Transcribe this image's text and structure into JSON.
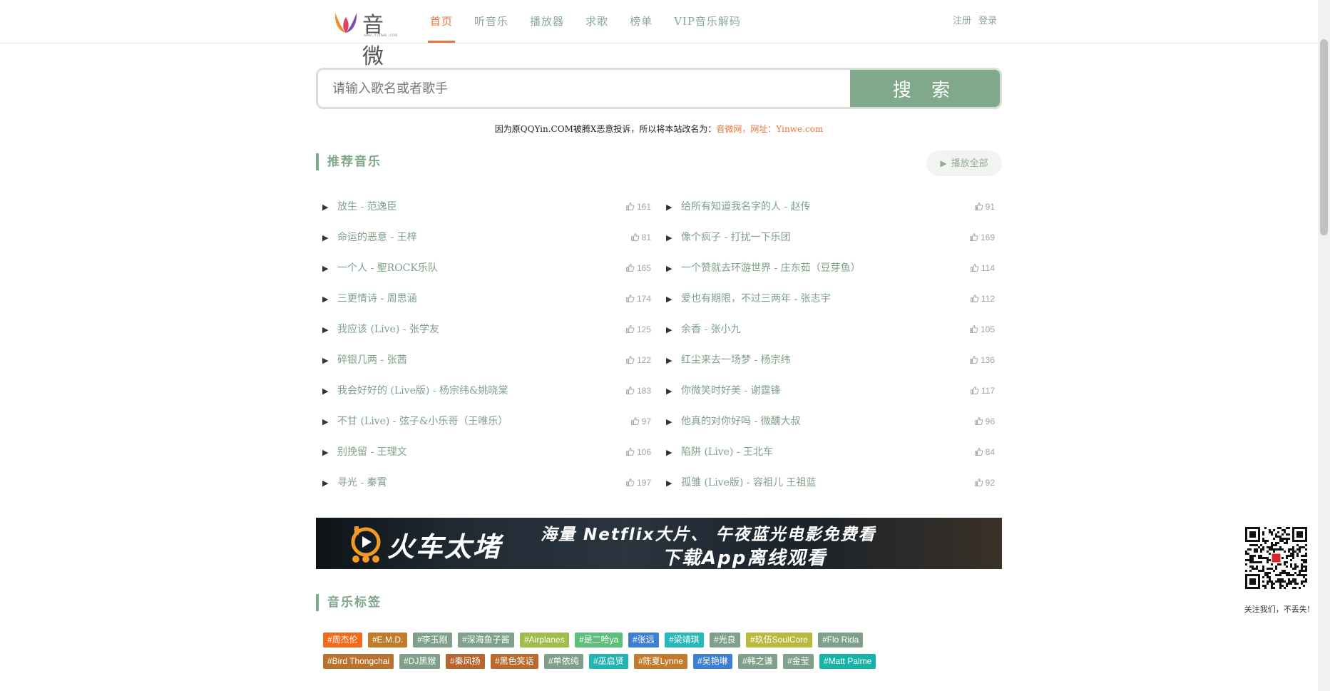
{
  "header": {
    "logo_text": "音微",
    "logo_sub": "www.Yinwe.com",
    "nav": [
      "首页",
      "听音乐",
      "播放器",
      "求歌",
      "榜单",
      "VIP音乐解码"
    ],
    "active_index": 0,
    "register": "注册",
    "login": "登录"
  },
  "search": {
    "placeholder": "请输入歌名或者歌手",
    "button": "搜 索"
  },
  "notice": {
    "text": "因为原QQYin.COM被腾X恶意投诉，所以将本站改名为：",
    "highlight": "音微网，网址：Yinwe.com"
  },
  "recommend": {
    "title": "推荐音乐",
    "play_all": "播放全部",
    "songs": [
      {
        "name": "放生 - 范逸臣",
        "likes": "161"
      },
      {
        "name": "给所有知道我名字的人 - 赵传",
        "likes": "91"
      },
      {
        "name": "命运的恶意 - 王梓",
        "likes": "81"
      },
      {
        "name": "像个疯子 - 打扰一下乐团",
        "likes": "169"
      },
      {
        "name": "一个人 - 聖ROCK乐队",
        "likes": "165"
      },
      {
        "name": "一个赞就去环游世界 - 庄东茹（豆芽鱼）",
        "likes": "114"
      },
      {
        "name": "三更情诗 - 周思涵",
        "likes": "174"
      },
      {
        "name": "爱也有期限，不过三两年 - 张志宇",
        "likes": "112"
      },
      {
        "name": "我应该 (Live) - 张学友",
        "likes": "125"
      },
      {
        "name": "余香 - 张小九",
        "likes": "105"
      },
      {
        "name": "碎银几两 - 张茜",
        "likes": "122"
      },
      {
        "name": "红尘来去一场梦 - 杨宗纬",
        "likes": "136"
      },
      {
        "name": "我会好好的 (Live版) - 杨宗纬&姚晓棠",
        "likes": "183"
      },
      {
        "name": "你微笑时好美 - 谢霆锋",
        "likes": "117"
      },
      {
        "name": "不甘 (Live) - 弦子&小乐哥（王唯乐）",
        "likes": "97"
      },
      {
        "name": "他真的对你好吗 - 微醺大叔",
        "likes": "96"
      },
      {
        "name": "别挽留 - 王理文",
        "likes": "106"
      },
      {
        "name": "陷阱 (Live) - 王北车",
        "likes": "84"
      },
      {
        "name": "寻光 - 秦霄",
        "likes": "197"
      },
      {
        "name": "孤雏 (Live版) - 容祖儿 王祖蓝",
        "likes": "92"
      }
    ]
  },
  "banner": {
    "brand": "火车太堵",
    "line1": "海量 Netflix大片、 午夜蓝光电影免费看",
    "line2": "下载App离线观看"
  },
  "tags_section": {
    "title": "音乐标签",
    "rows": [
      [
        {
          "label": "#周杰伦",
          "color": "#f26a1b"
        },
        {
          "label": "#E.M.D.",
          "color": "#c27a2c"
        },
        {
          "label": "#李玉刚",
          "color": "#7fa08a"
        },
        {
          "label": "#深海鱼子酱",
          "color": "#7fa08a"
        },
        {
          "label": "#Airplanes",
          "color": "#9fbd4a"
        },
        {
          "label": "#是二哈ya",
          "color": "#5cc07a"
        },
        {
          "label": "#张远",
          "color": "#3e7fd1"
        },
        {
          "label": "#梁靖琪",
          "color": "#27b8b8"
        },
        {
          "label": "#光良",
          "color": "#7fa08a"
        },
        {
          "label": "#玖伍SoulCore",
          "color": "#b9b940"
        },
        {
          "label": "#Flo Rida",
          "color": "#7fa08a"
        }
      ],
      [
        {
          "label": "#Bird Thongchai",
          "color": "#b7732f"
        },
        {
          "label": "#DJ黑猴",
          "color": "#7fa08a"
        },
        {
          "label": "#秦凤扬",
          "color": "#b7642f"
        },
        {
          "label": "#黑色笑话",
          "color": "#b86a2f"
        },
        {
          "label": "#单依纯",
          "color": "#7fa08a"
        },
        {
          "label": "#巫启贤",
          "color": "#22b3b3"
        },
        {
          "label": "#陈夏Lynne",
          "color": "#c27a2c"
        },
        {
          "label": "#吴艳琳",
          "color": "#3e7fd1"
        },
        {
          "label": "#韩之谦",
          "color": "#7fa08a"
        },
        {
          "label": "#金莹",
          "color": "#7fa08a"
        },
        {
          "label": "#Matt Palme",
          "color": "#16b3a6"
        }
      ]
    ]
  },
  "qr": {
    "caption": "关注我们，不丢失!"
  }
}
